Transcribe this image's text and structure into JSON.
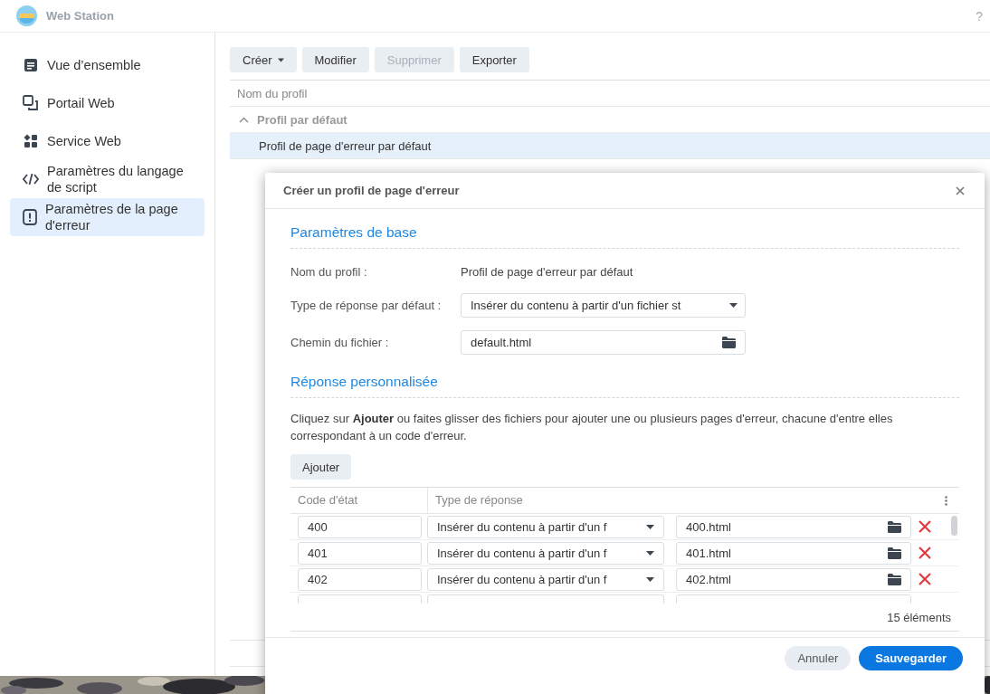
{
  "app": {
    "title": "Web Station",
    "help": "?"
  },
  "sidebar": {
    "items": [
      {
        "label": "Vue d’ensemble",
        "kind": "overview",
        "selected": false
      },
      {
        "label": "Portail Web",
        "kind": "portal",
        "selected": false
      },
      {
        "label": "Service Web",
        "kind": "service",
        "selected": false
      },
      {
        "label": "Paramètres du langage de script",
        "kind": "script",
        "selected": false
      },
      {
        "label": "Paramètres de la page d'erreur",
        "kind": "error",
        "selected": true
      }
    ]
  },
  "toolbar": {
    "buttons": [
      {
        "label": "Créer",
        "dropdown": true,
        "disabled": false
      },
      {
        "label": "Modifier",
        "dropdown": false,
        "disabled": false
      },
      {
        "label": "Supprimer",
        "dropdown": false,
        "disabled": true
      },
      {
        "label": "Exporter",
        "dropdown": false,
        "disabled": false
      }
    ]
  },
  "profile_table": {
    "columns": [
      "Nom du profil"
    ],
    "groups": [
      {
        "label": "Profil par défaut",
        "expanded": true,
        "rows": [
          {
            "name": "Profil de page d'erreur par défaut",
            "selected": true
          }
        ]
      }
    ]
  },
  "dialog": {
    "title": "Créer un profil de page d'erreur",
    "basic": {
      "heading": "Paramètres de base",
      "fields": [
        {
          "kind": "text",
          "label": "Nom du profil :",
          "value": "Profil de page d'erreur par défaut"
        },
        {
          "kind": "select",
          "label": "Type de réponse par défaut :",
          "value": "Insérer du contenu à partir d'un fichier st"
        },
        {
          "kind": "file",
          "label": "Chemin du fichier :",
          "value": "default.html"
        }
      ]
    },
    "custom": {
      "heading": "Réponse personnalisée",
      "description": "Cliquez sur **Ajouter** ou faites glisser des fichiers pour ajouter une ou plusieurs pages d'erreur, chacune d'entre elles correspondant à un code d'erreur.",
      "add_button": "Ajouter",
      "table": {
        "columns": [
          "Code d'état",
          "Type de réponse"
        ],
        "rows": [
          {
            "code": "400",
            "type": "Insérer du contenu à partir d'un f",
            "file": "400.html"
          },
          {
            "code": "401",
            "type": "Insérer du contenu à partir d'un f",
            "file": "401.html"
          },
          {
            "code": "402",
            "type": "Insérer du contenu à partir d'un f",
            "file": "402.html"
          }
        ],
        "count": "15 éléments"
      }
    },
    "buttons": [
      {
        "label": "Annuler",
        "primary": false
      },
      {
        "label": "Sauvegarder",
        "primary": true
      }
    ]
  }
}
